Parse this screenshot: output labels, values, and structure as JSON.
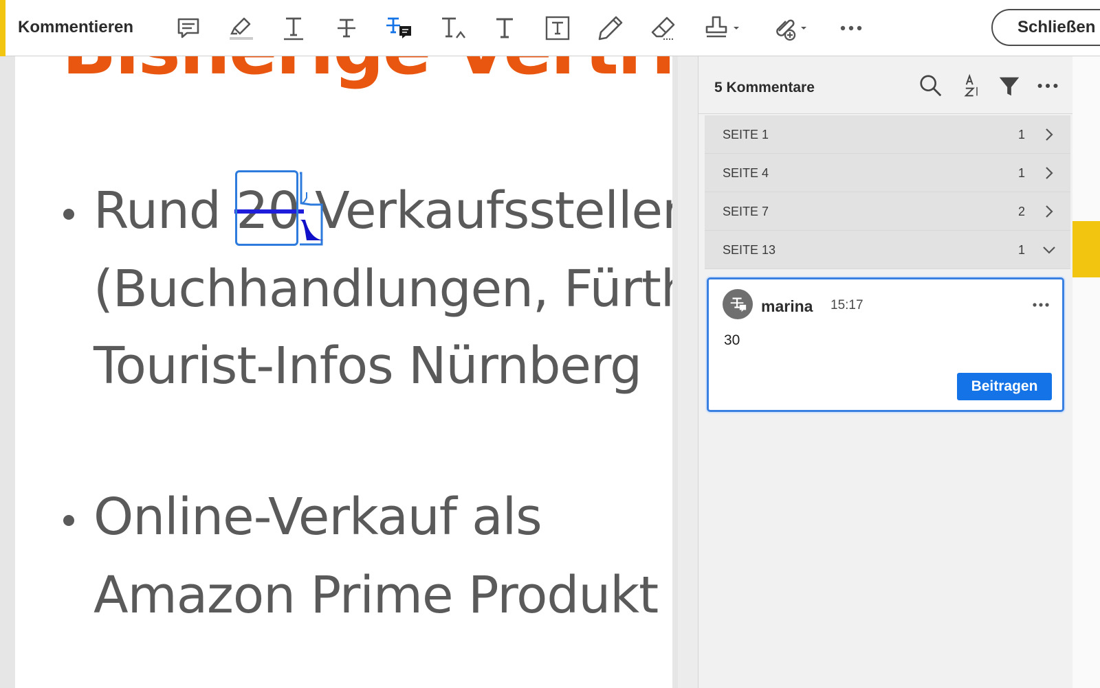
{
  "toolbar": {
    "title": "Kommentieren",
    "close_label": "Schließen",
    "tools": [
      "comment-icon",
      "highlight-icon",
      "underline-text-icon",
      "strikethrough-text-icon",
      "replace-text-icon",
      "insert-text-icon",
      "add-text-icon",
      "text-box-icon",
      "pencil-icon",
      "eraser-icon",
      "stamp-icon",
      "attach-icon",
      "more-icon"
    ]
  },
  "document": {
    "heading": "Bisherige Vertrie",
    "bullet1": {
      "pre": "Rund ",
      "struck": "20",
      "post": " Verkaufsstellen",
      "line2": "(Buchhandlungen, Fürth",
      "line3": "Tourist-Infos Nürnberg"
    },
    "bullet2": {
      "line1": "Online-Verkauf als",
      "line2": "Amazon Prime Produkt"
    }
  },
  "panel": {
    "count_label": "5 Kommentare",
    "pages": [
      {
        "label": "SEITE 1",
        "count": "1",
        "expanded": false
      },
      {
        "label": "SEITE 4",
        "count": "1",
        "expanded": false
      },
      {
        "label": "SEITE 7",
        "count": "2",
        "expanded": false
      },
      {
        "label": "SEITE 13",
        "count": "1",
        "expanded": true
      }
    ],
    "comment": {
      "author": "marina",
      "time": "15:17",
      "text": "30",
      "post_label": "Beitragen"
    }
  },
  "colors": {
    "accent": "#f2c511",
    "heading": "#e9560f",
    "primary": "#1473e6",
    "strike": "#1d1ddb"
  }
}
